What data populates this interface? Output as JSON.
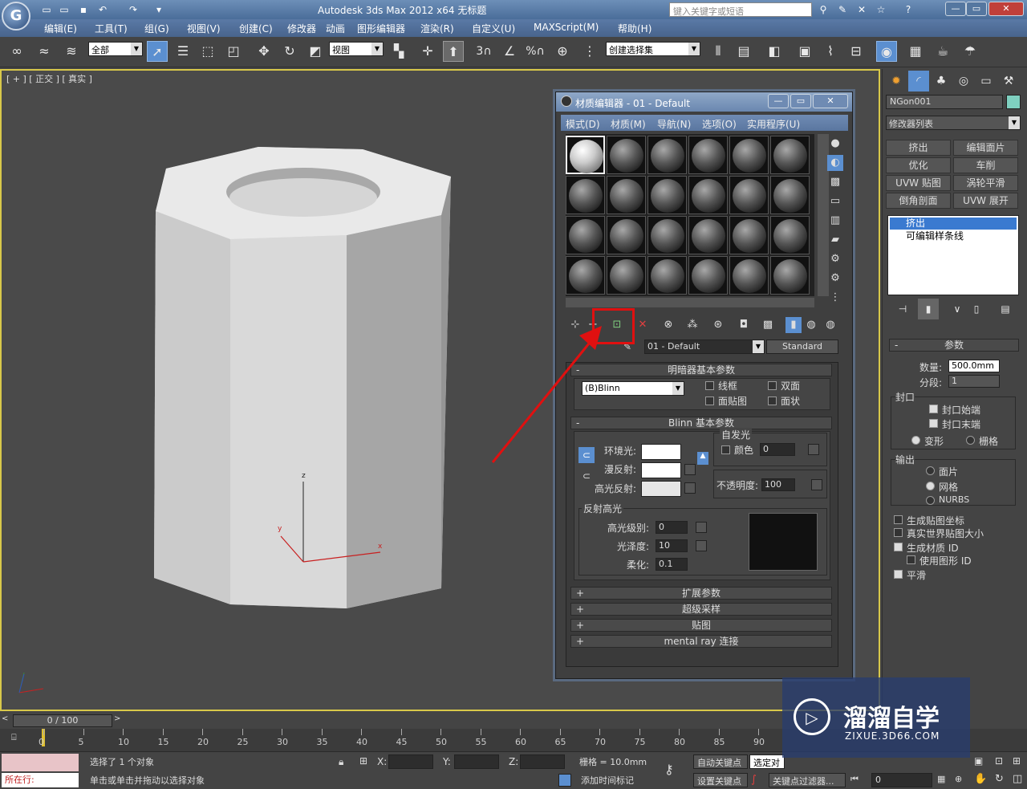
{
  "app": {
    "title": "Autodesk 3ds Max  2012 x64      无标题",
    "logo_letter": "G",
    "search_placeholder": "键入关键字或短语"
  },
  "menubar": [
    "编辑(E)",
    "工具(T)",
    "组(G)",
    "视图(V)",
    "创建(C)",
    "修改器",
    "动画",
    "图形编辑器",
    "渲染(R)",
    "自定义(U)",
    "MAXScript(M)",
    "帮助(H)"
  ],
  "toolbar": {
    "selection_filter": "全部",
    "coord_system": "视图",
    "named_selection": "创建选择集",
    "snap_3": "3",
    "percent_snap": "%"
  },
  "viewport": {
    "label": "[ + ] [ 正交 ] [ 真实 ]",
    "gizmo": {
      "x": "x",
      "y": "y",
      "z": "z"
    }
  },
  "material_editor": {
    "title": "材质编辑器 - 01 - Default",
    "menu": [
      "模式(D)",
      "材质(M)",
      "导航(N)",
      "选项(O)",
      "实用程序(U)"
    ],
    "material_name": "01 - Default",
    "material_type": "Standard",
    "shader_rollout": "明暗器基本参数",
    "shader": "(B)Blinn",
    "shader_opts": [
      "线框",
      "双面",
      "面贴图",
      "面状"
    ],
    "blinn_rollout": "Blinn 基本参数",
    "ambient": "环境光:",
    "diffuse": "漫反射:",
    "specular": "高光反射:",
    "self_illum": "自发光",
    "color_label": "颜色",
    "color_value": "0",
    "opacity_label": "不透明度:",
    "opacity_value": "100",
    "spec_group": "反射高光",
    "spec_level_label": "高光级别:",
    "spec_level": "0",
    "gloss_label": "光泽度:",
    "gloss": "10",
    "soften_label": "柔化:",
    "soften": "0.1",
    "collapsed": [
      "扩展参数",
      "超级采样",
      "贴图",
      "mental ray 连接"
    ],
    "colors": {
      "ambient": "#ffffff",
      "diffuse": "#ffffff",
      "specular": "#e6e6e6",
      "highlight_preview": "#111111"
    }
  },
  "command_panel": {
    "object_name": "NGon001",
    "object_color": "#7fd0c0",
    "modifier_list": "修改器列表",
    "buttons": [
      "挤出",
      "编辑面片",
      "优化",
      "车削",
      "UVW 贴图",
      "涡轮平滑",
      "倒角剖面",
      "UVW 展开"
    ],
    "stack": [
      "挤出",
      "可编辑样条线"
    ],
    "params_title": "参数",
    "amount_label": "数量:",
    "amount": "500.0mm",
    "segments_label": "分段:",
    "segments": "1",
    "capping": "封口",
    "cap_start": "封口始端",
    "cap_end": "封口末端",
    "morph": "变形",
    "grid": "栅格",
    "output": "输出",
    "out_patch": "面片",
    "out_mesh": "网格",
    "out_nurbs": "NURBS",
    "gen_map": "生成贴图坐标",
    "real_world": "真实世界贴图大小",
    "gen_mat_id": "生成材质 ID",
    "use_shape_id": "使用图形 ID",
    "smooth": "平滑"
  },
  "timeline": {
    "frame": "0 / 100",
    "ticks": [
      "0",
      "5",
      "10",
      "15",
      "20",
      "25",
      "30",
      "35",
      "40",
      "45",
      "50",
      "55",
      "60",
      "65",
      "70",
      "75",
      "80",
      "85",
      "90"
    ]
  },
  "status": {
    "mode_label": "所在行:",
    "selected": "选择了 1 个对象",
    "prompt": "单击或单击并拖动以选择对象",
    "x": "X:",
    "y": "Y:",
    "z": "Z:",
    "grid": "栅格 = 10.0mm",
    "add_time_tag": "添加时间标记",
    "auto_key": "自动关键点",
    "selected_obj": "选定对",
    "set_key": "设置关键点",
    "key_filter": "关键点过滤器...",
    "frame_value": "0"
  },
  "watermark": {
    "brand": "溜溜自学",
    "url": "ZIXUE.3D66.COM"
  }
}
